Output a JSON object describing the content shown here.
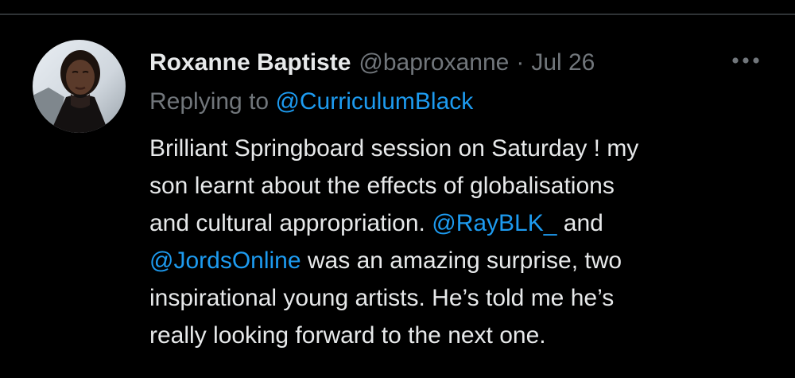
{
  "tweet": {
    "author": {
      "name": "Roxanne Baptiste",
      "handle": "@baproxanne"
    },
    "separator": "·",
    "date": "Jul 26",
    "reply": {
      "prefix": "Replying to ",
      "mention": "@CurriculumBlack"
    },
    "body": {
      "line1": "Brilliant Springboard session on Saturday ! my",
      "line2": "son learnt about the effects of globalisations",
      "line3_text": "and cultural appropriation. ",
      "line3_mention": "@RayBLK_",
      "line3_text_after": " and",
      "line4_mention": "@JordsOnline",
      "line4_text": " was an amazing surprise, two",
      "line5": "inspirational young artists. He’s told me he’s",
      "line6": "really looking forward to the next one."
    },
    "more_icon": "more-dots-icon"
  },
  "colors": {
    "background": "#000000",
    "text_primary": "#e7e9ea",
    "text_secondary": "#71767b",
    "link": "#1d9bf0",
    "divider": "#2f3336"
  }
}
